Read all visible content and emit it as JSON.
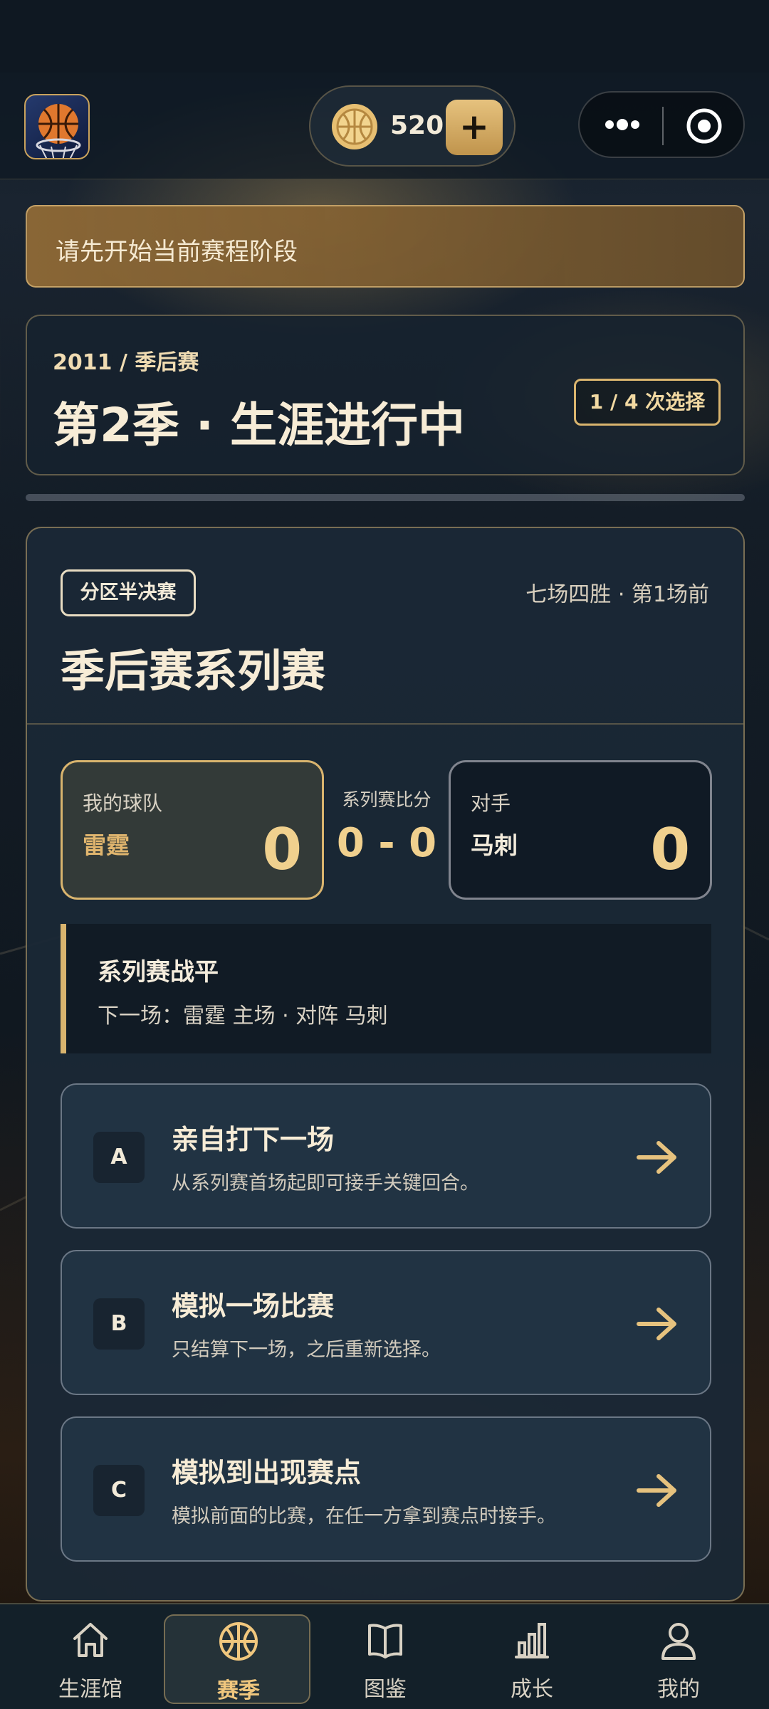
{
  "header": {
    "coins": "520",
    "plus_label": "+"
  },
  "notice": "请先开始当前赛程阶段",
  "season": {
    "subtitle": "2011 / 季后赛",
    "title": "第2季 · 生涯进行中",
    "choices": "1 / 4 次选择"
  },
  "series": {
    "round": "分区半决赛",
    "format": "七场四胜 · 第1场前",
    "title": "季后赛系列赛",
    "my_team": {
      "caption": "我的球队",
      "name": "雷霆",
      "score": "0"
    },
    "center": {
      "caption": "系列赛比分",
      "score": "0 - 0"
    },
    "opponent": {
      "caption": "对手",
      "name": "马刺",
      "score": "0"
    },
    "status": {
      "title": "系列赛战平",
      "subtitle": "下一场：雷霆 主场 · 对阵 马刺"
    }
  },
  "options": [
    {
      "letter": "A",
      "title": "亲自打下一场",
      "desc": "从系列赛首场起即可接手关键回合。"
    },
    {
      "letter": "B",
      "title": "模拟一场比赛",
      "desc": "只结算下一场，之后重新选择。"
    },
    {
      "letter": "C",
      "title": "模拟到出现赛点",
      "desc": "模拟前面的比赛，在任一方拿到赛点时接手。"
    }
  ],
  "nav": [
    {
      "label": "生涯馆",
      "icon": "home-icon"
    },
    {
      "label": "赛季",
      "icon": "basketball-icon",
      "active": true
    },
    {
      "label": "图鉴",
      "icon": "book-icon"
    },
    {
      "label": "成长",
      "icon": "bar-chart-icon"
    },
    {
      "label": "我的",
      "icon": "user-icon"
    }
  ],
  "colors": {
    "accent": "#d9b46e",
    "background": "#132029",
    "active_nav": "#f0c77e"
  }
}
